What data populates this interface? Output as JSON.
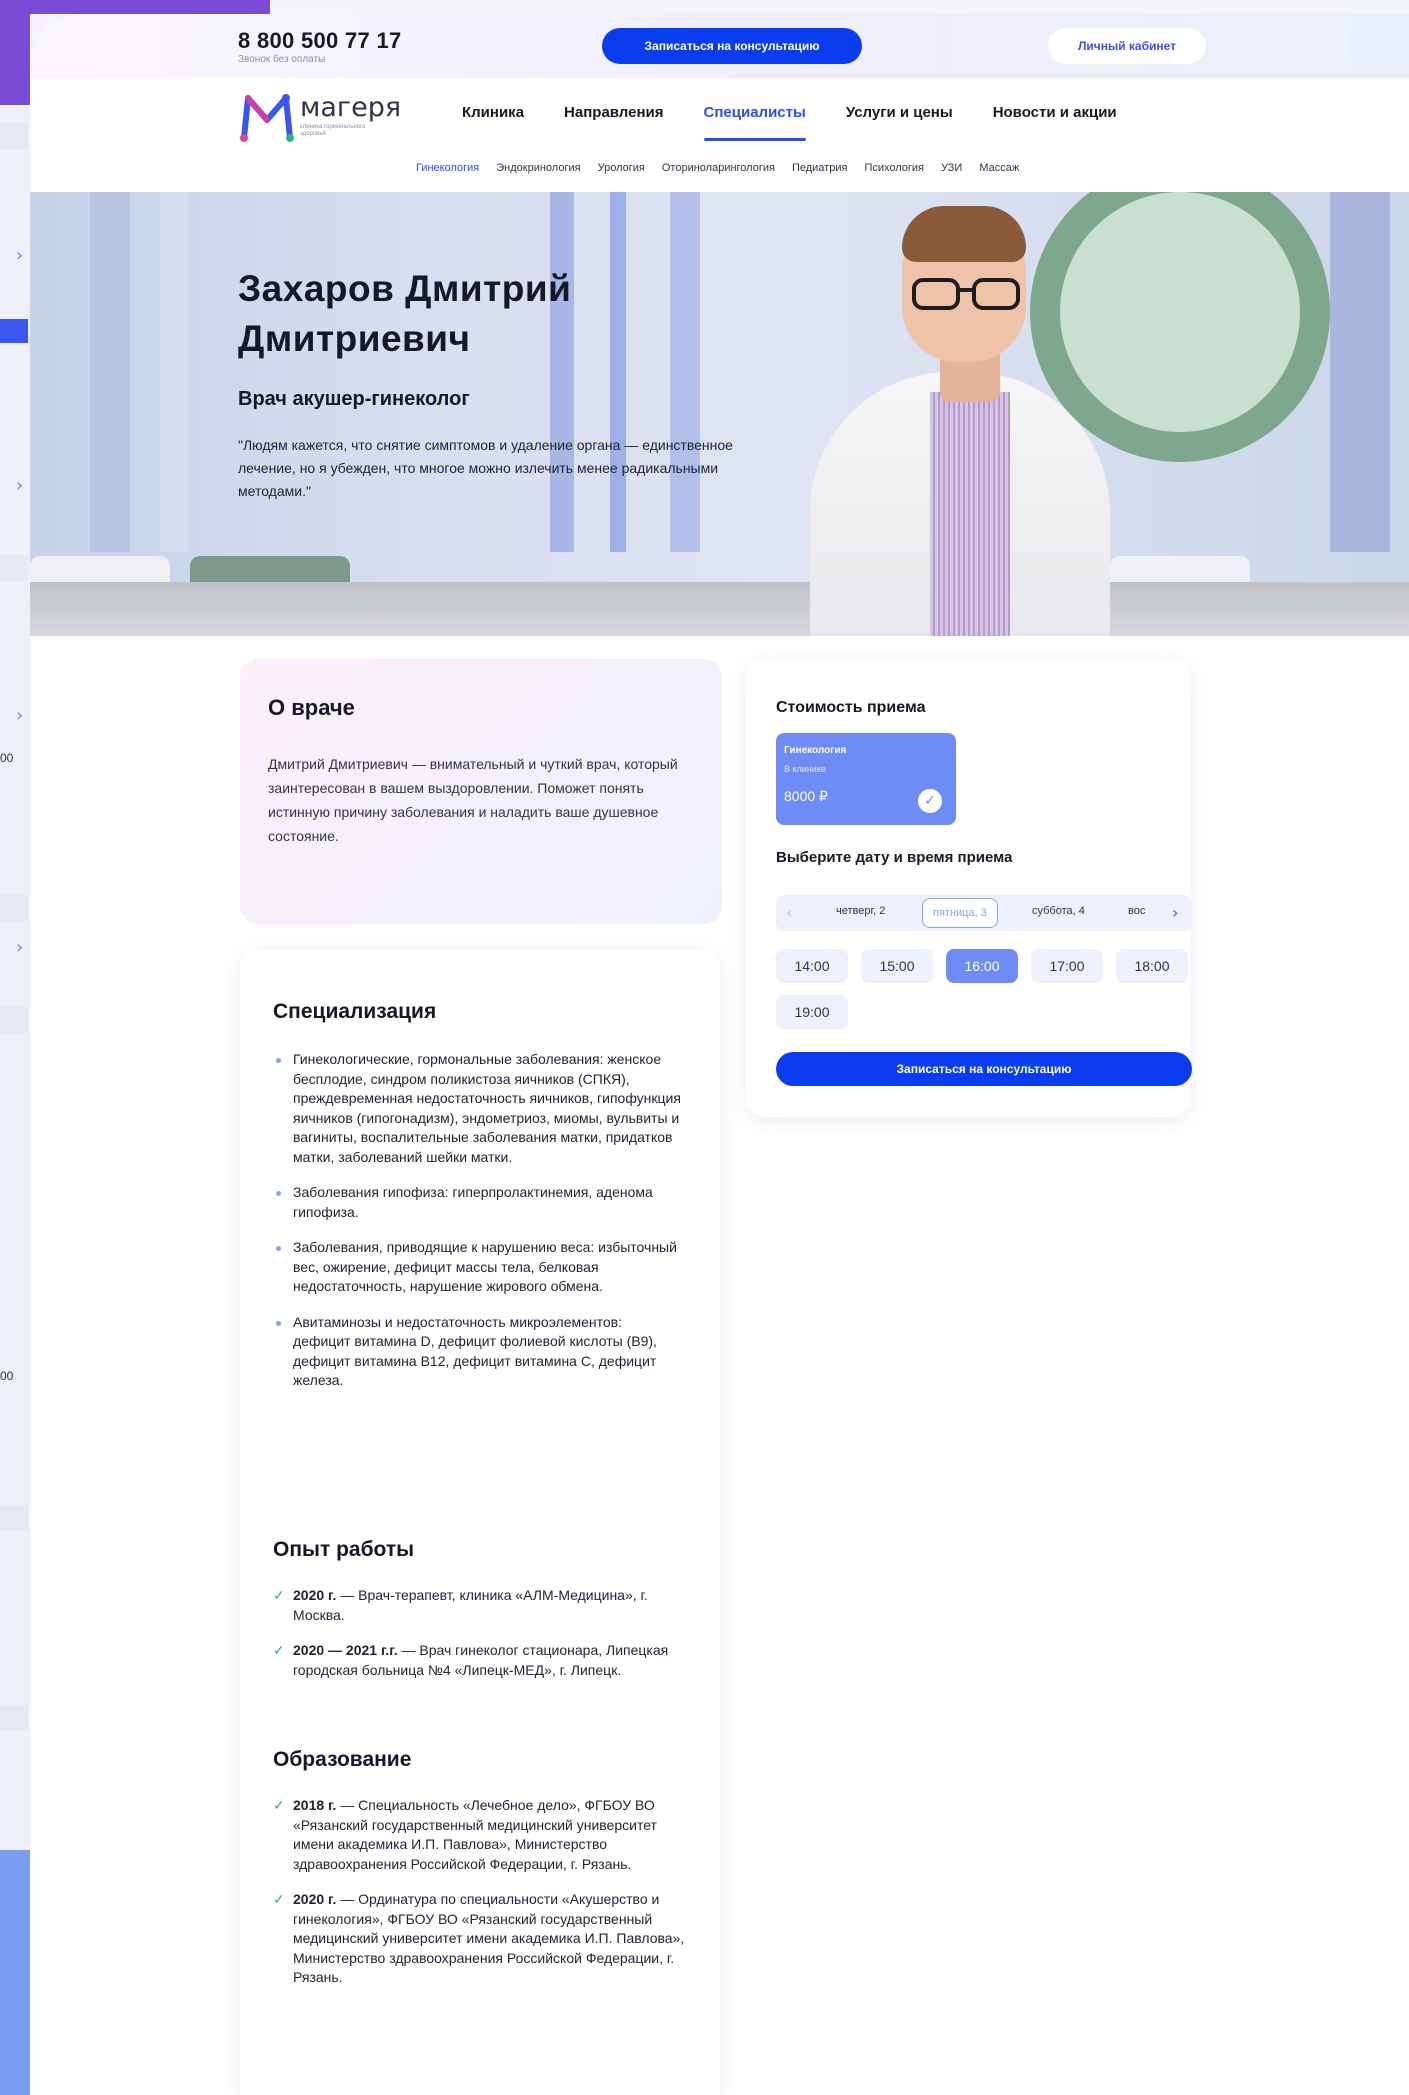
{
  "header": {
    "phone": "8 800 500 77 17",
    "phone_note": "Звонок без оплаты",
    "cta": "Записаться на консультацию",
    "cabinet": "Личный кабинет"
  },
  "logo": {
    "name": "магеря",
    "tagline": "клиника гормонального здоровья"
  },
  "nav": [
    "Клиника",
    "Направления",
    "Специалисты",
    "Услуги и цены",
    "Новости и акции"
  ],
  "nav_active": "Специалисты",
  "subnav": [
    "Гинекология",
    "Эндокринология",
    "Урология",
    "Оториноларингология",
    "Педиатрия",
    "Психология",
    "УЗИ",
    "Массаж"
  ],
  "side_rail": {
    "values": [
      "00",
      "00"
    ]
  },
  "hero": {
    "name": "Захаров Дмитрий Дмитриевич",
    "role": "Врач акушер-гинеколог",
    "quote": "\"Людям кажется, что снятие симптомов и удаление органа — единственное лечение, но я убежден, что многое можно излечить менее радикальными методами.\""
  },
  "about": {
    "title": "О враче",
    "text": "Дмитрий Дмитриевич — внимательный и чуткий врач, который заинтересован в вашем выздоровлении. Поможет понять истинную причину заболевания и наладить ваше душевное состояние."
  },
  "price": {
    "title": "Стоимость приема",
    "tile": {
      "service": "Гинекология",
      "mode": "В клинике",
      "price": "8000 ₽"
    },
    "date_title": "Выберите дату и время приема",
    "days": [
      "четверг, 2",
      "пятница, 3",
      "суббота, 4",
      "вос"
    ],
    "active_day": "пятница, 3",
    "slots": [
      "14:00",
      "15:00",
      "16:00",
      "17:00",
      "18:00",
      "19:00"
    ],
    "active_slot": "16:00",
    "book": "Записаться на консультацию"
  },
  "specialization": {
    "title": "Специализация",
    "items": [
      "Гинекологические, гормональные заболевания: женское бесплодие, синдром поликистоза яичников (СПКЯ), преждевременная недостаточность яичников, гипофункция яичников (гипогонадизм), эндометриоз, миомы, вульвиты и вагиниты, воспалительные заболевания матки, придатков матки, заболеваний шейки матки.",
      "Заболевания гипофиза: гиперпролактинемия, аденома гипофиза.",
      "Заболевания, приводящие к нарушению веса: избыточный вес, ожирение, дефицит массы тела, белковая недостаточность, нарушение жирового обмена.",
      "Авитаминозы и недостаточность микроэлементов: дефицит витамина D, дефицит фолиевой кислоты (B9), дефицит витамина B12, дефицит витамина C, дефицит железа."
    ]
  },
  "experience": {
    "title": "Опыт работы",
    "items": [
      {
        "years": "2020 г.",
        "text": " — Врач-терапевт, клиника «АЛМ-Медицина», г. Москва."
      },
      {
        "years": "2020 — 2021 г.г.",
        "text": " — Врач гинеколог стационара, Липецкая городская больница №4 «Липецк-МЕД», г. Липецк."
      }
    ]
  },
  "education": {
    "title": "Образование",
    "items": [
      {
        "years": "2018 г.",
        "text": " — Специальность «Лечебное дело», ФГБОУ ВО «Рязанский государственный медицинский университет имени академика И.П. Павлова», Министерство здравоохранения Российской Федерации, г. Рязань."
      },
      {
        "years": "2020 г.",
        "text": " — Ординатура по специальности «Акушерство и гинекология», ФГБОУ ВО «Рязанский государственный медицинский университет имени академика И.П. Павлова», Министерство здравоохранения Российской Федерации, г. Рязань."
      }
    ]
  },
  "icons": {
    "check": "check-icon",
    "chevron_left": "chevron-left-icon",
    "chevron_right": "chevron-right-icon"
  },
  "colors": {
    "primary": "#0a3df0",
    "accent": "#2a4ef2",
    "tile": "#6f8bf6",
    "check": "#1fb566"
  }
}
